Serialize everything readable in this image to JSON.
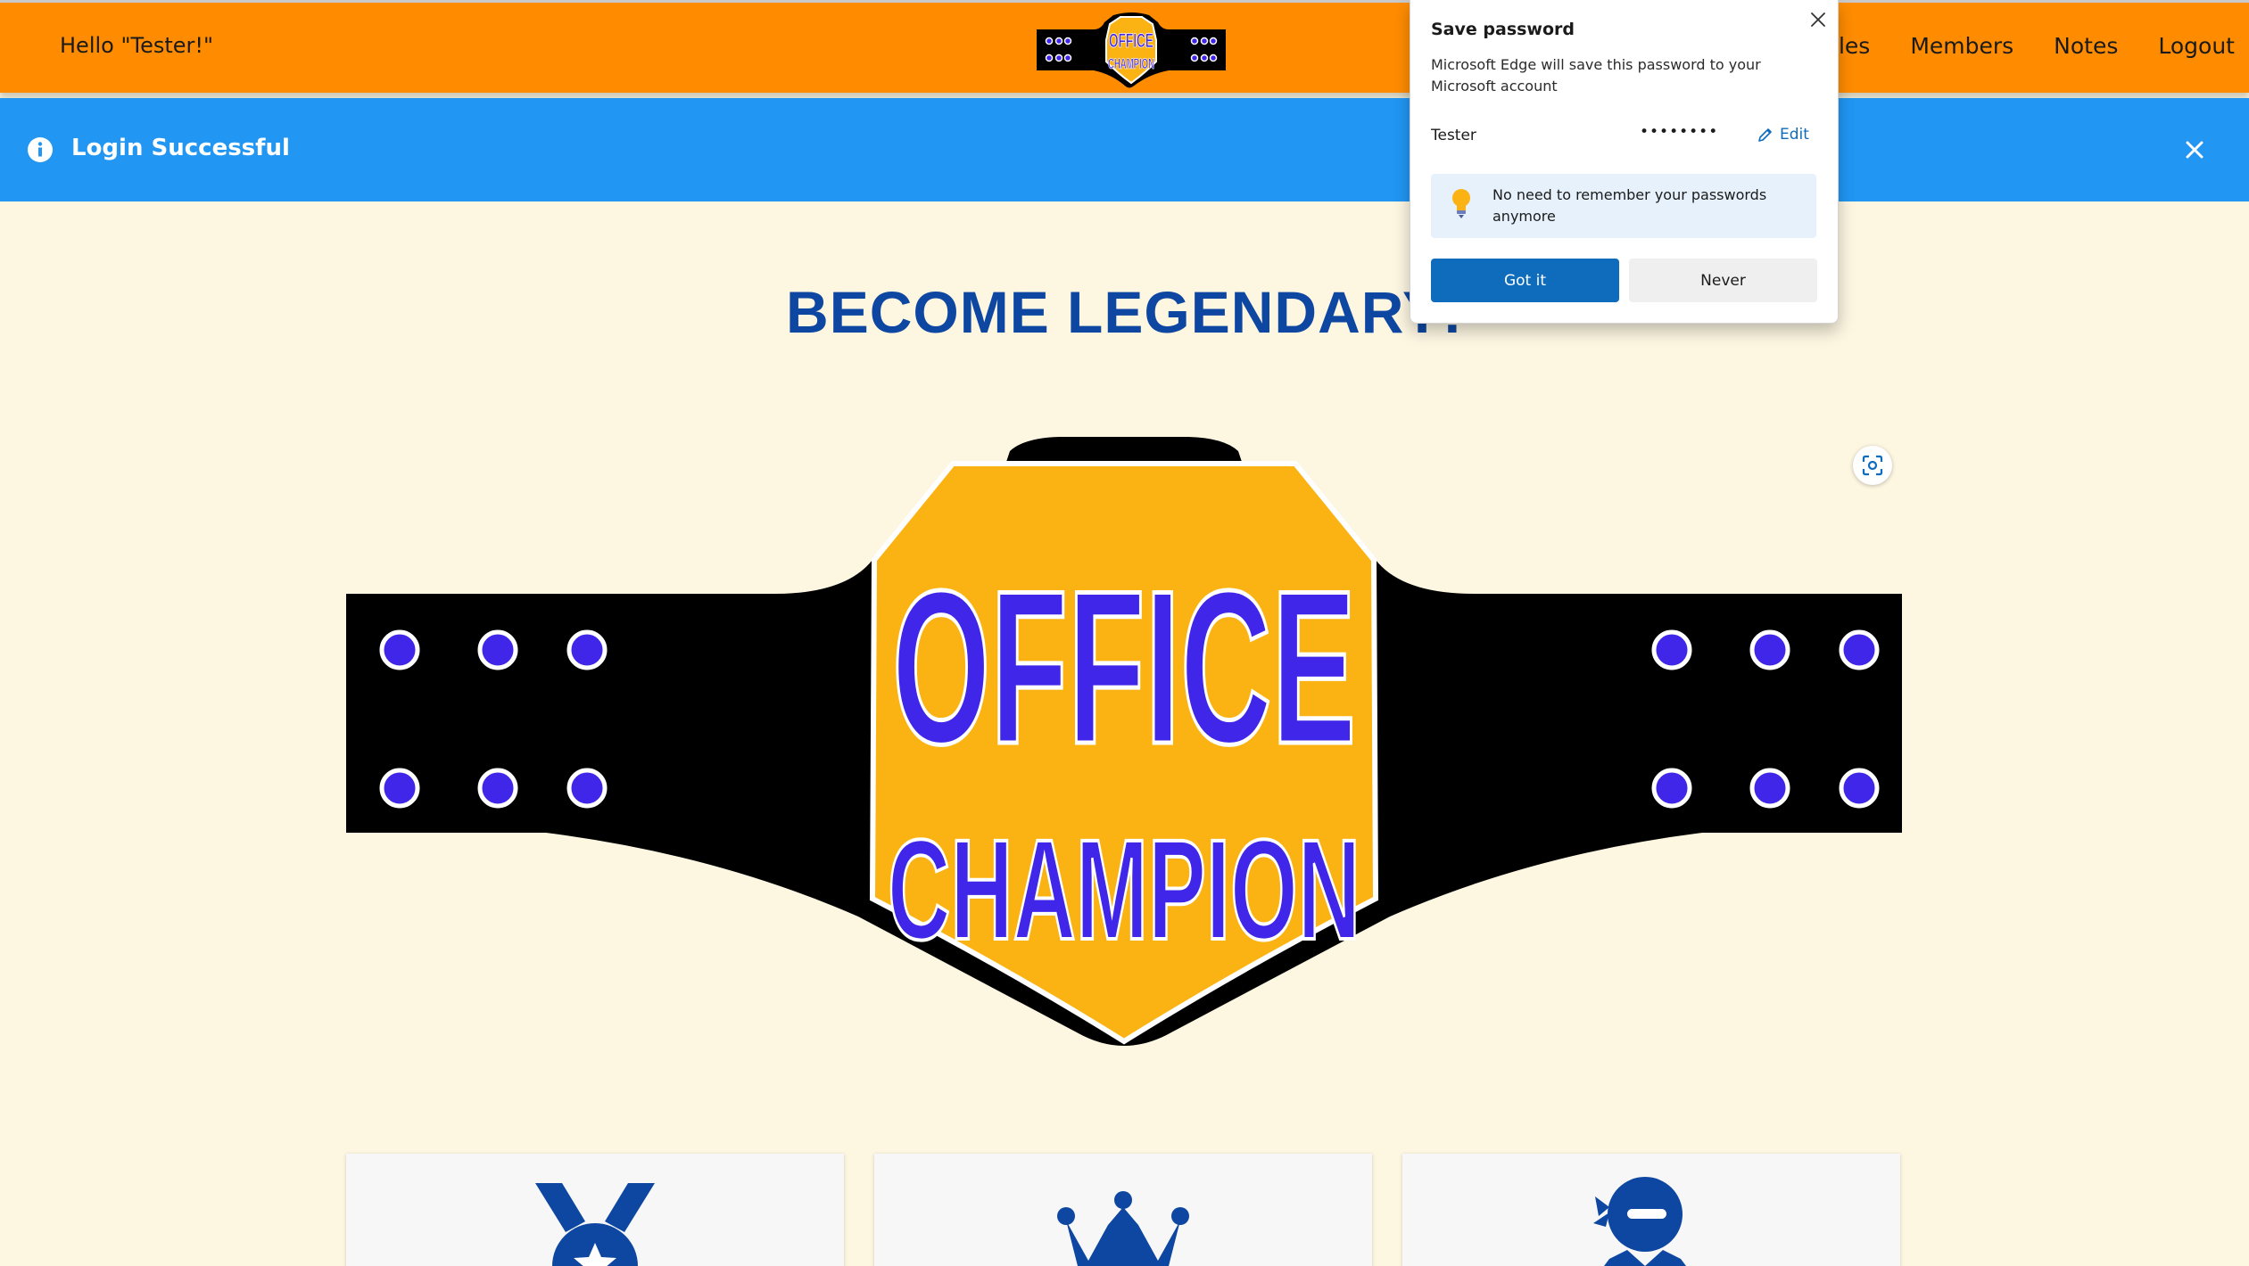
{
  "navbar": {
    "greeting": "Hello \"Tester!\"",
    "logo_line1": "OFFICE",
    "logo_line2": "CHAMPION",
    "links": [
      {
        "label": "Titles"
      },
      {
        "label": "Members"
      },
      {
        "label": "Notes"
      },
      {
        "label": "Logout"
      }
    ]
  },
  "alert": {
    "message": "Login Successful"
  },
  "hero": {
    "title": "BECOME LEGENDARY!",
    "belt_line1": "OFFICE",
    "belt_line2": "CHAMPION"
  },
  "password_popup": {
    "title": "Save password",
    "description": "Microsoft Edge will save this password to your Microsoft account",
    "username": "Tester",
    "password_mask": "••••••••",
    "edit_label": "Edit",
    "tip": "No need to remember your passwords anymore",
    "got_it_label": "Got it",
    "never_label": "Never"
  },
  "icons": {
    "cards": [
      "medal-icon",
      "crown-icon",
      "ninja-icon"
    ],
    "other": [
      "info-icon",
      "close-icon",
      "visual-search-icon",
      "pencil-icon",
      "lightbulb-icon"
    ]
  },
  "colors": {
    "navbar": "#ff8c00",
    "alert": "#2196f3",
    "title_blue": "#0d47a1",
    "background": "#fdf6e1",
    "belt_gold": "#fbb314",
    "belt_letters": "#3f26e9",
    "edge_blue": "#0f6cbd"
  }
}
